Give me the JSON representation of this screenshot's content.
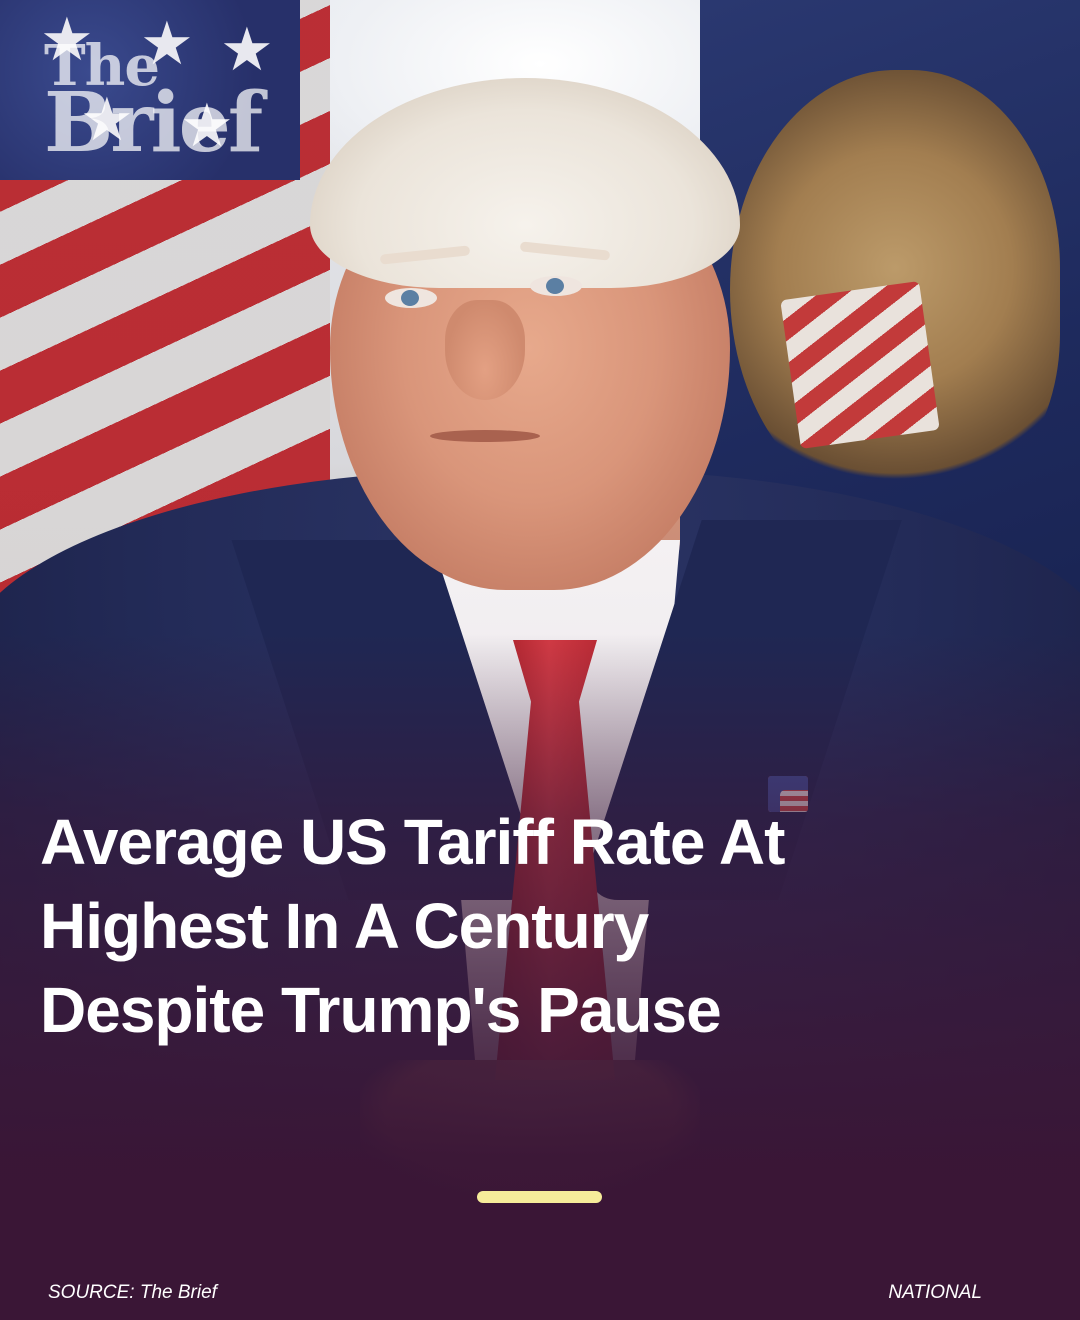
{
  "brand": {
    "logo_line1": "The",
    "logo_line2": "Brief"
  },
  "headline": {
    "line1": "Average US Tariff Rate At",
    "line2": "Highest In A Century",
    "line3": "Despite Trump's Pause"
  },
  "footer": {
    "source": "SOURCE: The Brief",
    "category": "NATIONAL"
  },
  "colors": {
    "background": "#3a1636",
    "accent_indicator": "#f6ec9a",
    "headline_text": "#ffffff"
  }
}
